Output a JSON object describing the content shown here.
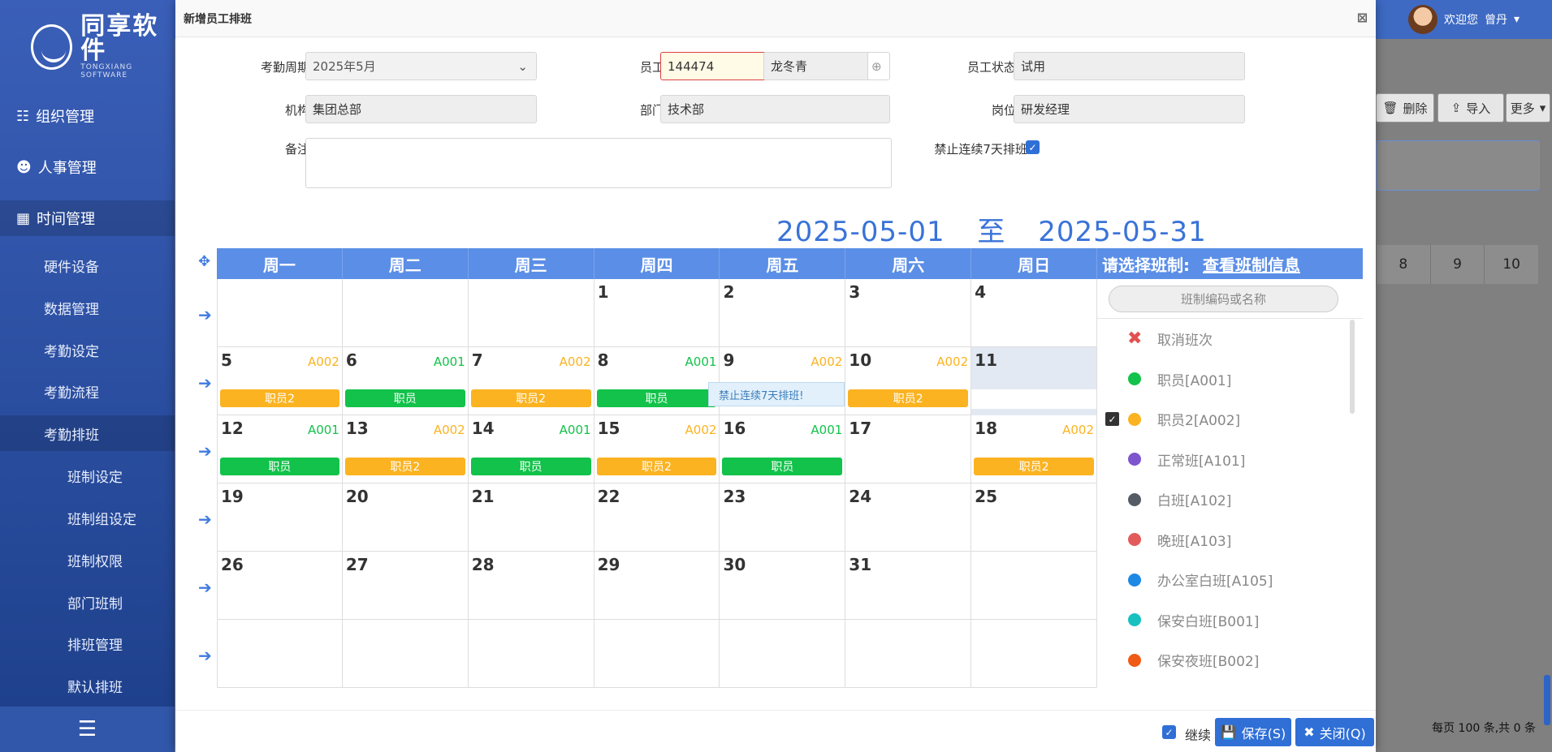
{
  "app": {
    "brand": "同享软件",
    "brand_sub": "TONGXIANG SOFTWARE"
  },
  "sidebar": {
    "items": [
      {
        "label": "组织管理",
        "icon": "org-chart-icon"
      },
      {
        "label": "人事管理",
        "icon": "people-icon"
      },
      {
        "label": "时间管理",
        "icon": "calendar-icon"
      }
    ],
    "sub_items": [
      "硬件设备",
      "数据管理",
      "考勤设定",
      "考勤流程",
      "考勤排班"
    ],
    "sub2_items": [
      "班制设定",
      "班制组设定",
      "班制权限",
      "部门班制",
      "排班管理",
      "默认排班"
    ],
    "collapse_icon": "collapse-menu-icon"
  },
  "topbar": {
    "welcome": "欢迎您",
    "user": "曾丹"
  },
  "background": {
    "buttons": [
      "删除",
      "导入",
      "更多"
    ],
    "table_header": [
      "8",
      "9",
      "10"
    ],
    "footer": "每页 100 条,共 0 条"
  },
  "modal": {
    "title": "新增员工排班",
    "form": {
      "period_label": "考勤周期:",
      "period_value": "2025年5月",
      "employee_label": "员工:",
      "employee_id": "144474",
      "employee_name": "龙冬青",
      "status_label": "员工状态:",
      "status_value": "试用",
      "org_label": "机构:",
      "org_value": "集团总部",
      "dept_label": "部门:",
      "dept_value": "技术部",
      "post_label": "岗位:",
      "post_value": "研发经理",
      "remark_label": "备注:",
      "remark_value": "",
      "ban7_label": "禁止连续7天排班:",
      "ban7_checked": true
    },
    "range": {
      "start": "2025-05-01",
      "sep": "至",
      "end": "2025-05-31"
    },
    "weekdays": [
      "周一",
      "周二",
      "周三",
      "周四",
      "周五",
      "周六",
      "周日"
    ],
    "weeks": [
      [
        {
          "d": ""
        },
        {
          "d": ""
        },
        {
          "d": ""
        },
        {
          "d": "1"
        },
        {
          "d": "2"
        },
        {
          "d": "3"
        },
        {
          "d": "4"
        }
      ],
      [
        {
          "d": "5",
          "code": "A002",
          "label": "职员2",
          "color": "#fbb321"
        },
        {
          "d": "6",
          "code": "A001",
          "label": "职员",
          "color": "#12c24a"
        },
        {
          "d": "7",
          "code": "A002",
          "label": "职员2",
          "color": "#fbb321"
        },
        {
          "d": "8",
          "code": "A001",
          "label": "职员",
          "color": "#12c24a"
        },
        {
          "d": "9",
          "code": "A002",
          "label": "",
          "color": "#fbb321"
        },
        {
          "d": "10",
          "code": "A002",
          "label": "职员2",
          "color": "#fbb321"
        },
        {
          "d": "11",
          "selected": true
        }
      ],
      [
        {
          "d": "12",
          "code": "A001",
          "label": "职员",
          "color": "#12c24a"
        },
        {
          "d": "13",
          "code": "A002",
          "label": "职员2",
          "color": "#fbb321"
        },
        {
          "d": "14",
          "code": "A001",
          "label": "职员",
          "color": "#12c24a"
        },
        {
          "d": "15",
          "code": "A002",
          "label": "职员2",
          "color": "#fbb321"
        },
        {
          "d": "16",
          "code": "A001",
          "label": "职员",
          "color": "#12c24a"
        },
        {
          "d": "17"
        },
        {
          "d": "18",
          "code": "A002",
          "label": "职员2",
          "color": "#fbb321"
        }
      ],
      [
        {
          "d": "19"
        },
        {
          "d": "20"
        },
        {
          "d": "21"
        },
        {
          "d": "22"
        },
        {
          "d": "23"
        },
        {
          "d": "24"
        },
        {
          "d": "25"
        }
      ],
      [
        {
          "d": "26"
        },
        {
          "d": "27"
        },
        {
          "d": "28"
        },
        {
          "d": "29"
        },
        {
          "d": "30"
        },
        {
          "d": "31"
        },
        {
          "d": ""
        }
      ],
      [
        {
          "d": ""
        },
        {
          "d": ""
        },
        {
          "d": ""
        },
        {
          "d": ""
        },
        {
          "d": ""
        },
        {
          "d": ""
        },
        {
          "d": ""
        }
      ]
    ],
    "tooltip": "禁止连续7天排班!",
    "panel": {
      "title": "请选择班制:",
      "link": "查看班制信息",
      "search_placeholder": "班制编码或名称",
      "shifts": [
        {
          "label": "取消班次",
          "cancel": true
        },
        {
          "label": "职员[A001]",
          "color": "#12c24a"
        },
        {
          "label": "职员2[A002]",
          "color": "#fbb321",
          "picked": true
        },
        {
          "label": "正常班[A101]",
          "color": "#7c55cf"
        },
        {
          "label": "白班[A102]",
          "color": "#555c66"
        },
        {
          "label": "晚班[A103]",
          "color": "#e35a5a"
        },
        {
          "label": "办公室白班[A105]",
          "color": "#1e88e5"
        },
        {
          "label": "保安白班[B001]",
          "color": "#18c0c0"
        },
        {
          "label": "保安夜班[B002]",
          "color": "#f05a14"
        }
      ]
    },
    "footer": {
      "continue_label": "继续",
      "continue_checked": true,
      "save": "保存(S)",
      "close": "关闭(Q)"
    }
  }
}
